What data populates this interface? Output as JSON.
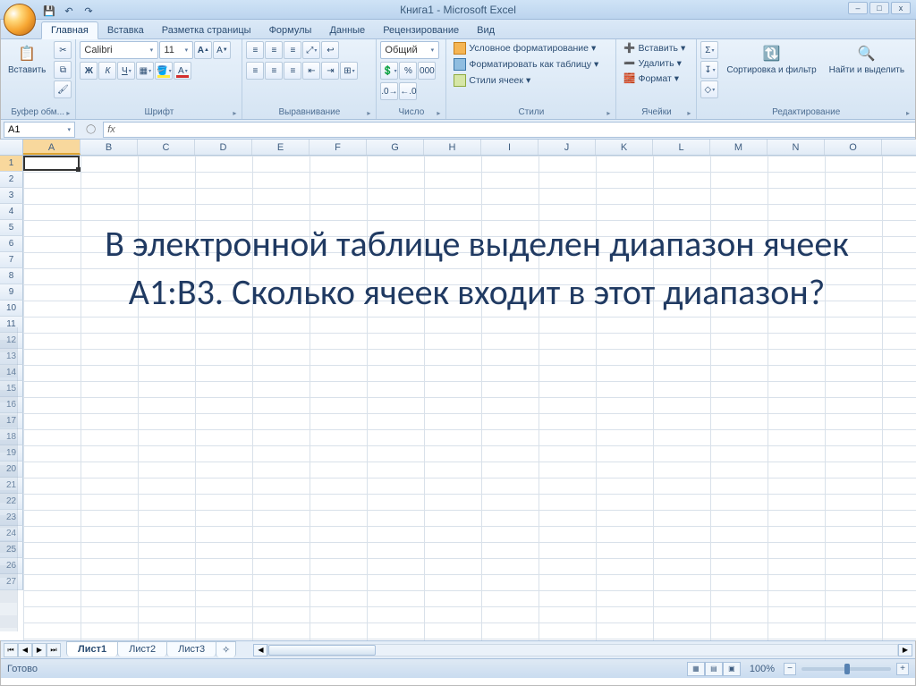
{
  "title": "Книга1 - Microsoft Excel",
  "window": {
    "min": "–",
    "max": "□",
    "close": "x"
  },
  "qat": {
    "save": "💾",
    "undo": "↶",
    "redo": "↷"
  },
  "tabs": {
    "items": [
      "Главная",
      "Вставка",
      "Разметка страницы",
      "Формулы",
      "Данные",
      "Рецензирование",
      "Вид"
    ],
    "active": 0
  },
  "ribbon": {
    "clipboard": {
      "paste": "Вставить",
      "label": "Буфер обм..."
    },
    "font": {
      "name": "Calibri",
      "size": "11",
      "grow": "A",
      "shrink": "A",
      "bold": "Ж",
      "italic": "К",
      "underline": "Ч",
      "label": "Шрифт"
    },
    "alignment": {
      "label": "Выравнивание"
    },
    "number": {
      "format": "Общий",
      "label": "Число"
    },
    "styles": {
      "cond": "Условное форматирование",
      "table": "Форматировать как таблицу",
      "cell": "Стили ячеек",
      "label": "Стили"
    },
    "cells": {
      "insert": "Вставить",
      "delete": "Удалить",
      "format": "Формат",
      "label": "Ячейки"
    },
    "editing": {
      "sort": "Сортировка и фильтр",
      "find": "Найти и выделить",
      "sum": "Σ",
      "fill": "↧",
      "clear": "◇",
      "label": "Редактирование"
    }
  },
  "formula_bar": {
    "namebox": "A1",
    "fx": "fx"
  },
  "columns": [
    "A",
    "B",
    "C",
    "D",
    "E",
    "F",
    "G",
    "H",
    "I",
    "J",
    "K",
    "L",
    "M",
    "N",
    "O"
  ],
  "rows": 27,
  "question": "В электронной таблице выделен диапазон ячеек A1:B3. Сколько ячеек входит в этот диапазон?",
  "sheets": {
    "items": [
      "Лист1",
      "Лист2",
      "Лист3"
    ],
    "active": 0
  },
  "status": {
    "ready": "Готово",
    "zoom": "100%"
  }
}
